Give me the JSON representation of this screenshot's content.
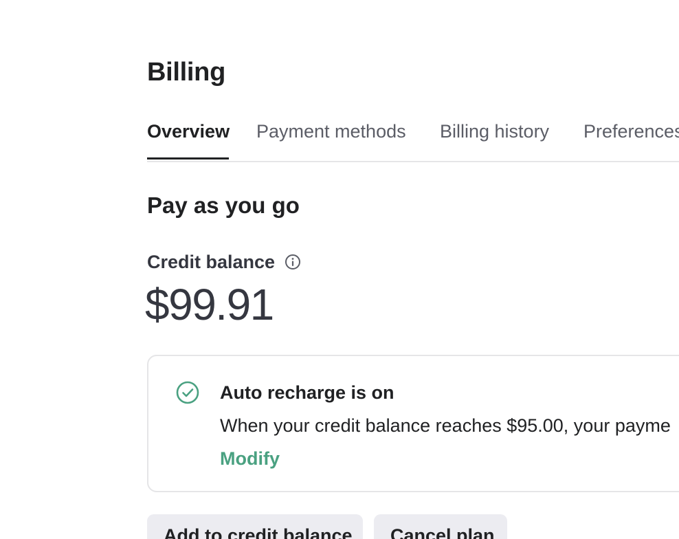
{
  "page": {
    "title": "Billing"
  },
  "tabs": [
    {
      "label": "Overview",
      "active": true
    },
    {
      "label": "Payment methods",
      "active": false
    },
    {
      "label": "Billing history",
      "active": false
    },
    {
      "label": "Preferences",
      "active": false
    }
  ],
  "plan": {
    "title": "Pay as you go",
    "credit_label": "Credit balance",
    "credit_info_icon": "info-icon",
    "credit_amount": "$99.91"
  },
  "auto_recharge": {
    "status_icon": "check-circle-icon",
    "title": "Auto recharge is on",
    "description": "When your credit balance reaches $95.00, your payme",
    "modify_label": "Modify"
  },
  "actions": {
    "add_credit_label": "Add to credit balance",
    "cancel_plan_label": "Cancel plan"
  },
  "colors": {
    "accent_green": "#4aa181",
    "text_primary": "#202123",
    "text_secondary": "#5b5d66",
    "border": "#e5e5e7",
    "button_bg": "#ececf1"
  }
}
